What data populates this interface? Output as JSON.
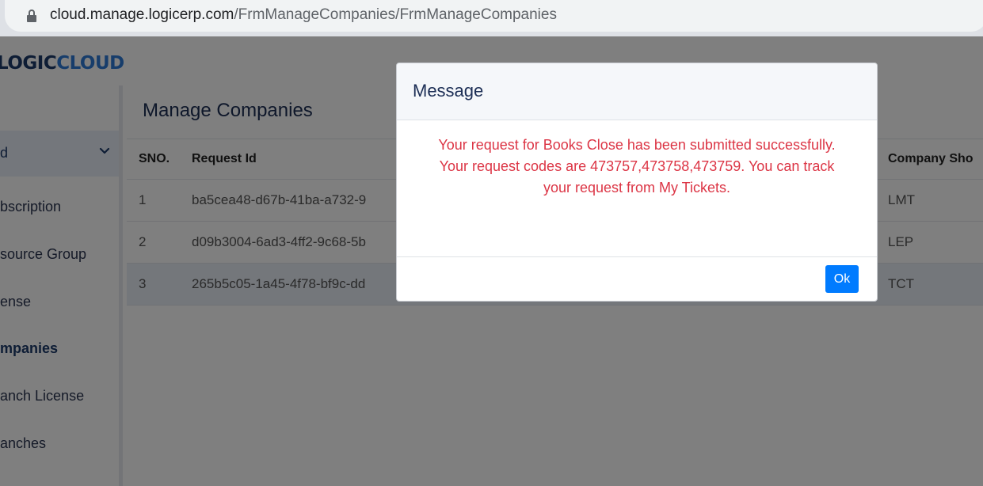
{
  "browser": {
    "url_host": "cloud.manage.logicerp.com",
    "url_path": "/FrmManageCompanies/FrmManageCompanies"
  },
  "logo": {
    "part1": "LOGIC",
    "part2": "CLOUD"
  },
  "sidebar": {
    "active_label": "d",
    "items": [
      {
        "label": "bscription"
      },
      {
        "label": "source Group"
      },
      {
        "label": "ense"
      },
      {
        "label": "mpanies"
      },
      {
        "label": "anch License"
      },
      {
        "label": "anches"
      }
    ]
  },
  "main": {
    "title": "Manage Companies",
    "columns": [
      "SNO.",
      "Request Id",
      "Company Sho"
    ],
    "rows": [
      {
        "sno": "1",
        "request_id": "ba5cea48-d67b-41ba-a732-9",
        "short": "LMT"
      },
      {
        "sno": "2",
        "request_id": "d09b3004-6ad3-4ff2-9c68-5b",
        "short": "LEP"
      },
      {
        "sno": "3",
        "request_id": "265b5c05-1a45-4f78-bf9c-dd",
        "short": "TCT"
      }
    ]
  },
  "modal": {
    "title": "Message",
    "body": "Your request for Books Close has been submitted successfully. Your request codes are 473757,473758,473759. You can track your request from My Tickets.",
    "ok_label": "Ok"
  },
  "colors": {
    "accent": "#007bff",
    "message_text": "#dc3545",
    "logo_dark": "#1c3a6b",
    "logo_light": "#2e7bd6"
  }
}
